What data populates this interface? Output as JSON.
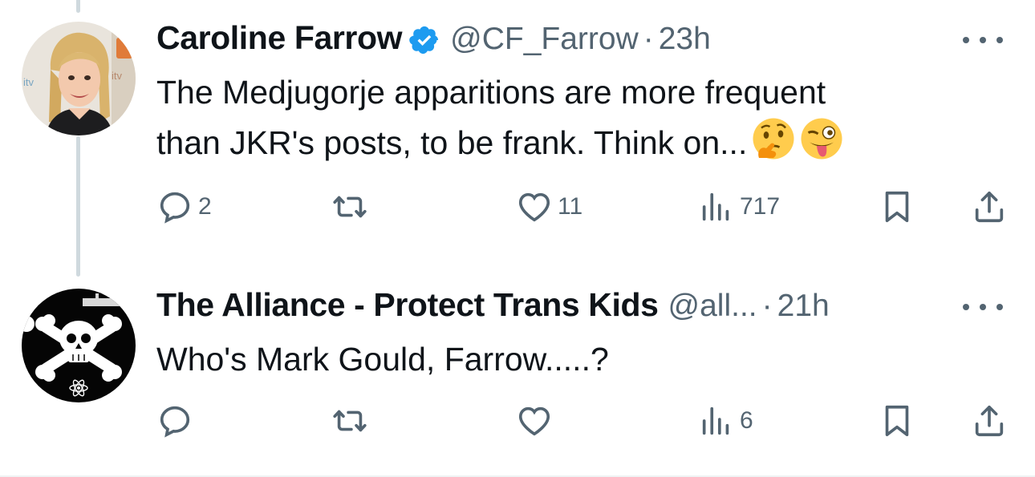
{
  "tweets": [
    {
      "author": "Caroline Farrow",
      "verified": true,
      "handle": "@CF_Farrow",
      "separator": "·",
      "time": "23h",
      "text": "The Medjugorje apparitions are more frequent\nthan JKR's posts, to be frank. Think on...",
      "text_line1": "The Medjugorje apparitions are more frequent",
      "text_line2": "than JKR's posts, to be frank. Think on...",
      "emojis": [
        "thinking-face",
        "winking-face-with-tongue"
      ],
      "replies": "2",
      "retweets": "",
      "likes": "11",
      "views": "717",
      "avatar_logo_text": "itv"
    },
    {
      "author": "The Alliance - Protect Trans Kids",
      "verified": false,
      "handle": "@all...",
      "separator": "·",
      "time": "21h",
      "text_line1": "Who's Mark Gould, Farrow.....?",
      "replies": "",
      "retweets": "",
      "likes": "",
      "views": "6"
    }
  ],
  "colors": {
    "text": "#0f1419",
    "secondary": "#536471",
    "verified_blue": "#1d9bf0",
    "thread_line": "#cfd9de"
  }
}
